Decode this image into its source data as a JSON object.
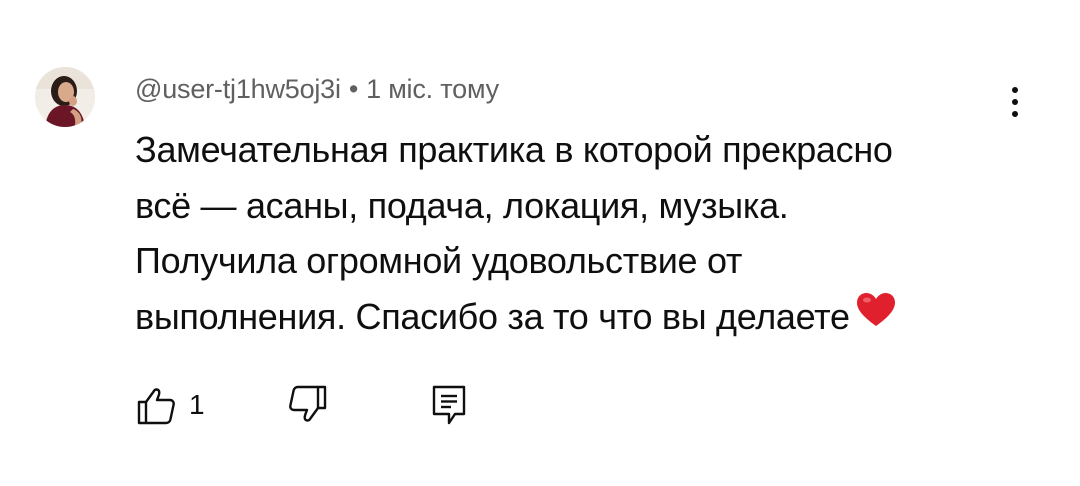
{
  "comment": {
    "author": "@user-tj1hw5oj3i",
    "separator": "•",
    "time": "1 міс. тому",
    "text_lines": [
      "Замечательная практика в которой прекрасно",
      "всё — асаны, подача, локация, музыка.",
      "Получила огромной удовольствие от",
      "выполнения. Спасибо за то что вы делаете"
    ],
    "emoji": "heart-emoji",
    "likes": "1"
  },
  "icons": {
    "menu": "vertical-ellipsis-icon",
    "like": "thumbs-up-icon",
    "dislike": "thumbs-down-icon",
    "reply": "comment-icon"
  },
  "colors": {
    "text": "#0f0f0f",
    "meta": "#606060",
    "heart": "#e0202c"
  }
}
